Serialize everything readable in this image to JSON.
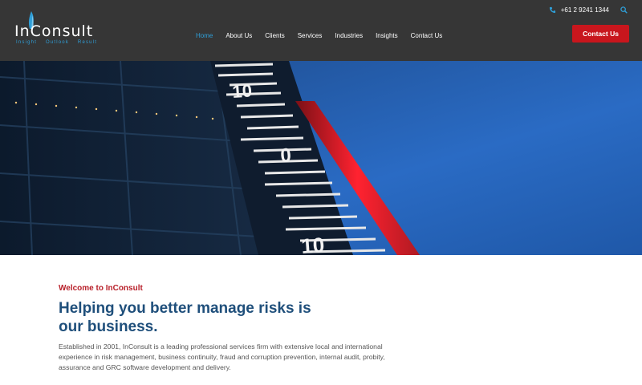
{
  "brand": {
    "name": "InConsult",
    "taglines": [
      "Insight",
      "Outlook",
      "Result"
    ],
    "accent_color": "#2f9fd8",
    "cta_color": "#c8161d",
    "heading_color": "#1f4f7b",
    "eyebrow_color": "#b8202a"
  },
  "topbar": {
    "phone": "+61 2 9241 1344",
    "phone_icon": "phone-icon",
    "search_icon": "search-icon"
  },
  "nav": {
    "items": [
      {
        "label": "Home",
        "active": true
      },
      {
        "label": "About Us"
      },
      {
        "label": "Clients"
      },
      {
        "label": "Services"
      },
      {
        "label": "Industries"
      },
      {
        "label": "Insights"
      },
      {
        "label": "Contact Us"
      }
    ]
  },
  "header_cta": {
    "label": "Contact Us"
  },
  "hero": {
    "scale_labels": [
      "10",
      "0",
      "10"
    ]
  },
  "intro": {
    "eyebrow": "Welcome to InConsult",
    "headline": "Helping you better manage risks is our business.",
    "body": "Established in 2001, InConsult is a leading professional services firm with extensive local and international experience in risk management, business continuity, fraud and corruption prevention, internal audit, probity, assurance and GRC software development and delivery."
  }
}
